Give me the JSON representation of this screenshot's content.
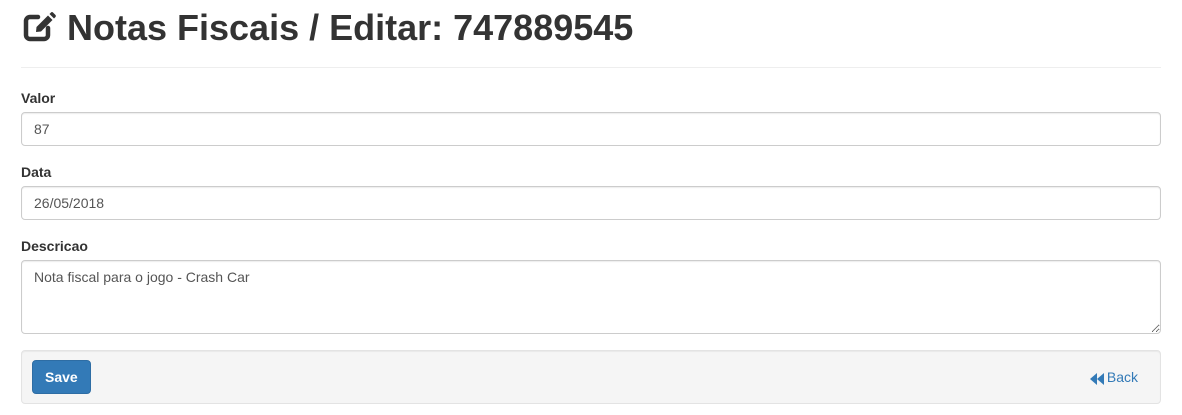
{
  "header": {
    "title": "Notas Fiscais / Editar: 747889545",
    "icon": "edit-icon"
  },
  "form": {
    "valor": {
      "label": "Valor",
      "value": "87"
    },
    "data": {
      "label": "Data",
      "value": "26/05/2018"
    },
    "descricao": {
      "label": "Descricao",
      "value": "Nota fiscal para o jogo - Crash Car"
    }
  },
  "actions": {
    "save_label": "Save",
    "back_label": "Back",
    "back_icon": "backward-icon"
  },
  "colors": {
    "primary": "#337ab7",
    "link": "#337ab7",
    "text": "#333333",
    "well_bg": "#f5f5f5"
  }
}
